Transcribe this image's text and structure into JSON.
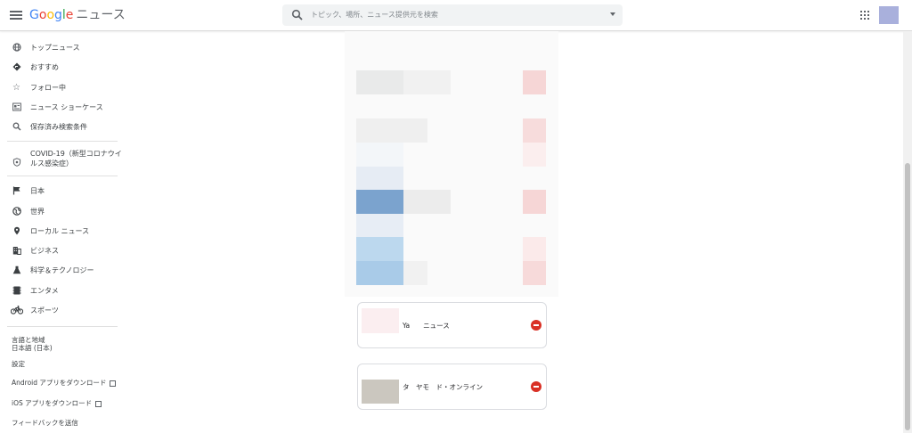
{
  "header": {
    "logo_letters": [
      "G",
      "o",
      "o",
      "g",
      "l",
      "e"
    ],
    "product": "ニュース",
    "search_placeholder": "トピック、場所、ニュース提供元を検索"
  },
  "sidebar": {
    "items": [
      {
        "label": "トップニュース",
        "icon": "globe-icon"
      },
      {
        "label": "おすすめ",
        "icon": "diamond-icon"
      },
      {
        "label": "フォロー中",
        "icon": "star-icon"
      },
      {
        "label": "ニュース ショーケース",
        "icon": "newspaper-icon"
      },
      {
        "label": "保存済み検索条件",
        "icon": "search-icon"
      },
      {
        "label": "COVID-19（新型コロナウイルス感染症）",
        "icon": "shield-icon"
      },
      {
        "label": "日本",
        "icon": "flag-icon"
      },
      {
        "label": "世界",
        "icon": "world-icon"
      },
      {
        "label": "ローカル ニュース",
        "icon": "location-pin-icon"
      },
      {
        "label": "ビジネス",
        "icon": "building-icon"
      },
      {
        "label": "科学＆テクノロジー",
        "icon": "flask-icon"
      },
      {
        "label": "エンタメ",
        "icon": "film-icon"
      },
      {
        "label": "スポーツ",
        "icon": "bicycle-icon"
      }
    ],
    "footer": {
      "language_title": "言語と地域",
      "language_value": "日本語 (日本)",
      "settings": "設定",
      "android_app": "Android アプリをダウンロード",
      "ios_app": "iOS アプリをダウンロード",
      "feedback": "フィードバックを送信"
    }
  },
  "main": {
    "sources": [
      {
        "name": "Ya　　ニュース",
        "thumb_color": "#fbeef0"
      },
      {
        "name": "タ　ヤモ　ド・オンライン",
        "thumb_color": "#cbc7bf"
      }
    ]
  },
  "colors": {
    "accent_red": "#d93025",
    "blurred_blue_dark": "#7ba3ce",
    "blurred_blue_light": "#bcd8ee",
    "blurred_pink": "#f6d6d6",
    "avatar": "#a9b0dc"
  }
}
